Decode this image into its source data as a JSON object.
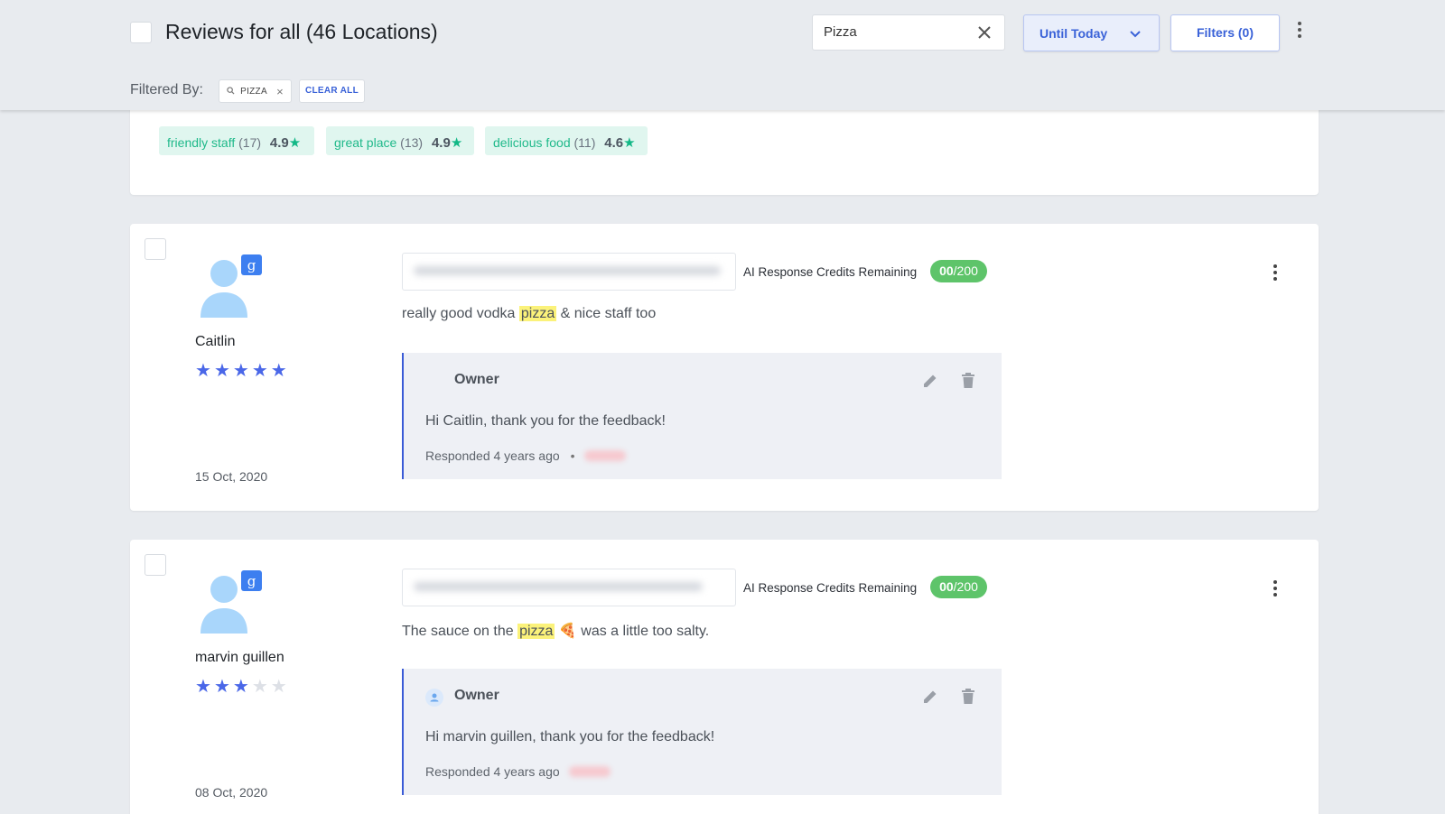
{
  "header": {
    "title": "Reviews for all (46 Locations)",
    "search_value": "Pizza",
    "until_label": "Until Today",
    "filters_label": "Filters (0)",
    "filtered_by_label": "Filtered By:",
    "chip_label": "PIZZA",
    "chip_close": "×",
    "clear_all_label": "CLEAR ALL"
  },
  "tags": [
    {
      "name": "friendly staff",
      "count": "(17)",
      "score": "4.9",
      "star": "★"
    },
    {
      "name": "great place",
      "count": "(13)",
      "score": "4.9",
      "star": "★"
    },
    {
      "name": "delicious food",
      "count": "(11)",
      "score": "4.6",
      "star": "★"
    }
  ],
  "reviews": [
    {
      "reviewer": "Caitlin",
      "rating": 5,
      "date": "15 Oct, 2020",
      "credits_label": "AI Response Credits Remaining",
      "credits_used": "00",
      "credits_total": "/200",
      "text_before": "really good vodka ",
      "highlight": "pizza",
      "text_after": " & nice staff too",
      "reply": {
        "author": "Owner",
        "text": "Hi Caitlin, thank you for the feedback!",
        "meta": "Responded 4 years ago",
        "separator": "•"
      }
    },
    {
      "reviewer": "marvin guillen",
      "rating": 3,
      "date": "08 Oct, 2020",
      "credits_label": "AI Response Credits Remaining",
      "credits_used": "00",
      "credits_total": "/200",
      "text_before": "The sauce on the ",
      "highlight": "pizza",
      "text_after": " 🍕 was a little too salty.",
      "reply": {
        "author": "Owner",
        "text": "Hi marvin guillen, thank you for the feedback!",
        "meta": "Responded 4 years ago",
        "separator": ""
      }
    }
  ],
  "colors": {
    "accent": "#3a62d8",
    "star_on": "#4a67e8",
    "tag_green": "#1fb98a",
    "credits_green": "#5ec46a",
    "highlight": "#fbf27a"
  },
  "icons": {
    "star_glyph": "★",
    "google_badge": "g"
  }
}
